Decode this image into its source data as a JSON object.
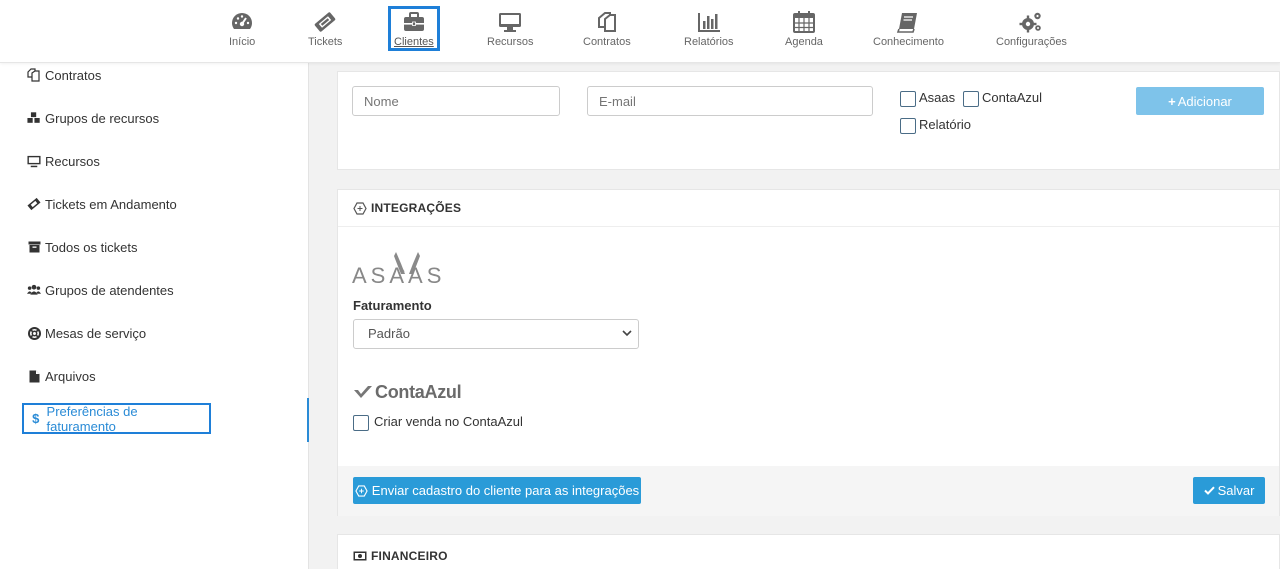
{
  "nav": {
    "items": [
      {
        "label": "Início",
        "icon": "dashboard-icon"
      },
      {
        "label": "Tickets",
        "icon": "ticket-icon"
      },
      {
        "label": "Clientes",
        "icon": "briefcase-icon"
      },
      {
        "label": "Recursos",
        "icon": "desktop-icon"
      },
      {
        "label": "Contratos",
        "icon": "copy-icon"
      },
      {
        "label": "Relatórios",
        "icon": "bar-chart-icon"
      },
      {
        "label": "Agenda",
        "icon": "calendar-icon"
      },
      {
        "label": "Conhecimento",
        "icon": "book-icon"
      },
      {
        "label": "Configurações",
        "icon": "gears-icon"
      }
    ],
    "active": "Clientes"
  },
  "sidebar": {
    "items": [
      {
        "label": "Contratos",
        "icon": "copy-icon"
      },
      {
        "label": "Grupos de recursos",
        "icon": "cubes-icon"
      },
      {
        "label": "Recursos",
        "icon": "desktop-icon"
      },
      {
        "label": "Tickets em Andamento",
        "icon": "ticket-icon"
      },
      {
        "label": "Todos os tickets",
        "icon": "archive-icon"
      },
      {
        "label": "Grupos de atendentes",
        "icon": "users-icon"
      },
      {
        "label": "Mesas de serviço",
        "icon": "lifebuoy-icon"
      },
      {
        "label": "Arquivos",
        "icon": "file-icon"
      },
      {
        "label": "Preferências de faturamento",
        "icon": "dollar-icon"
      }
    ],
    "active": "Preferências de faturamento"
  },
  "contact_form": {
    "name_placeholder": "Nome",
    "email_placeholder": "E-mail",
    "checkboxes": {
      "asaas": "Asaas",
      "contaazul": "ContaAzul",
      "relatorio": "Relatório"
    },
    "add_button": "Adicionar"
  },
  "integrations": {
    "title": "INTEGRAÇÕES",
    "asaas_logo": "ASAAS",
    "billing_label": "Faturamento",
    "billing_value": "Padrão",
    "contaazul_logo": "ContaAzul",
    "create_sale_label": "Criar venda no ContaAzul",
    "send_button": "Enviar cadastro do cliente para as integrações",
    "save_button": "Salvar"
  },
  "financeiro": {
    "title": "FINANCEIRO"
  },
  "colors": {
    "accent": "#2a9bd8",
    "active_outline": "#1e7fd8",
    "add_button": "#7ec3ea"
  }
}
